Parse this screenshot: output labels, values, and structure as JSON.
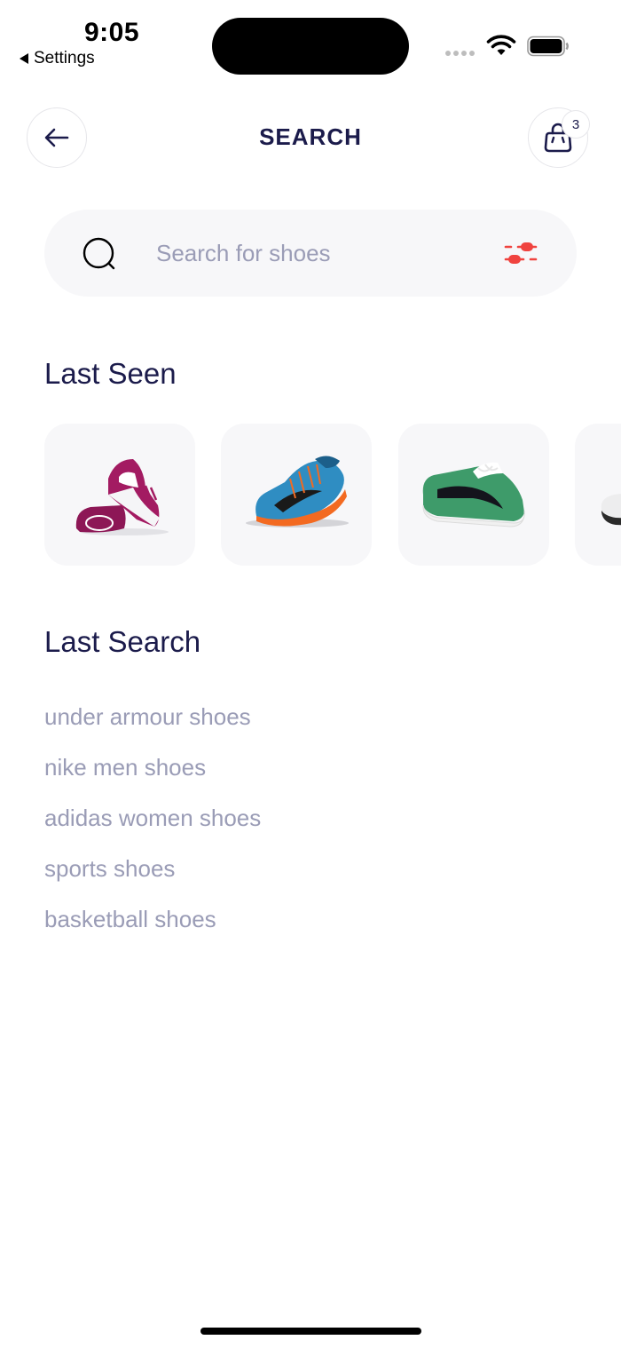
{
  "status_bar": {
    "time": "9:05",
    "back_app": "Settings"
  },
  "header": {
    "title": "SEARCH",
    "cart_count": "3"
  },
  "search": {
    "placeholder": "Search for shoes",
    "value": ""
  },
  "last_seen": {
    "title": "Last Seen",
    "items": [
      {
        "icon": "magenta-white-sneaker"
      },
      {
        "icon": "blue-orange-running-shoe"
      },
      {
        "icon": "green-suede-sneaker"
      },
      {
        "icon": "white-sneaker-partial"
      }
    ]
  },
  "last_search": {
    "title": "Last Search",
    "items": [
      "under armour shoes",
      "nike men shoes",
      "adidas women shoes",
      "sports shoes",
      "basketball shoes"
    ]
  },
  "colors": {
    "primary_text": "#1b1b4b",
    "muted_text": "#9a9cb6",
    "surface": "#f7f7f9",
    "accent": "#f0433f"
  }
}
